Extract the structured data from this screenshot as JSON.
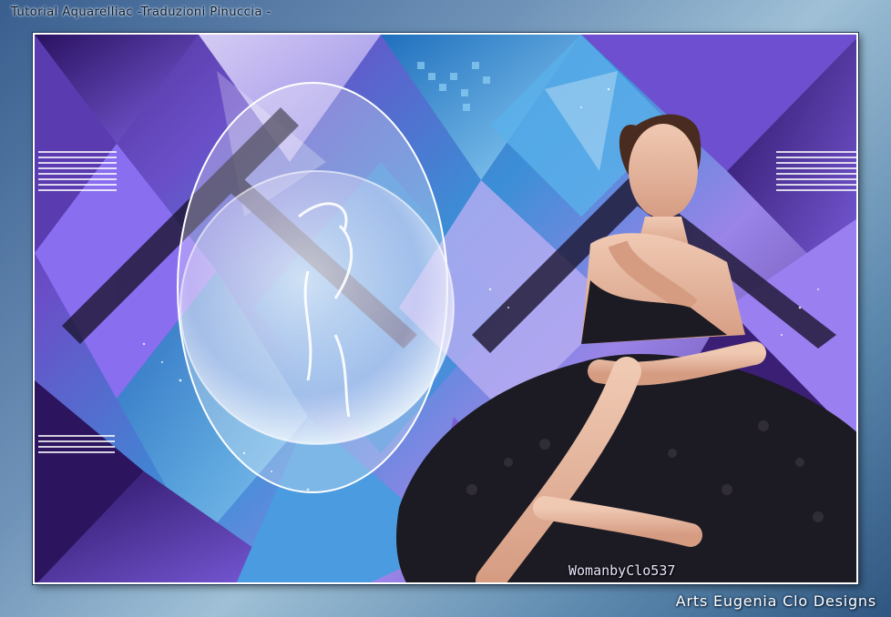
{
  "header": {
    "title": "Tutorial Aquarelliac -Traduzioni Pinuccia -"
  },
  "artwork": {
    "signature": "WomanbyClo537"
  },
  "footer": {
    "credit": "Arts Eugenia Clo Designs"
  },
  "colors": {
    "deep_purple": "#3a1f74",
    "violet": "#7b5fd6",
    "sky_blue": "#3fa3e0",
    "lavender": "#c9bff5",
    "frame_border": "#ffffff"
  }
}
